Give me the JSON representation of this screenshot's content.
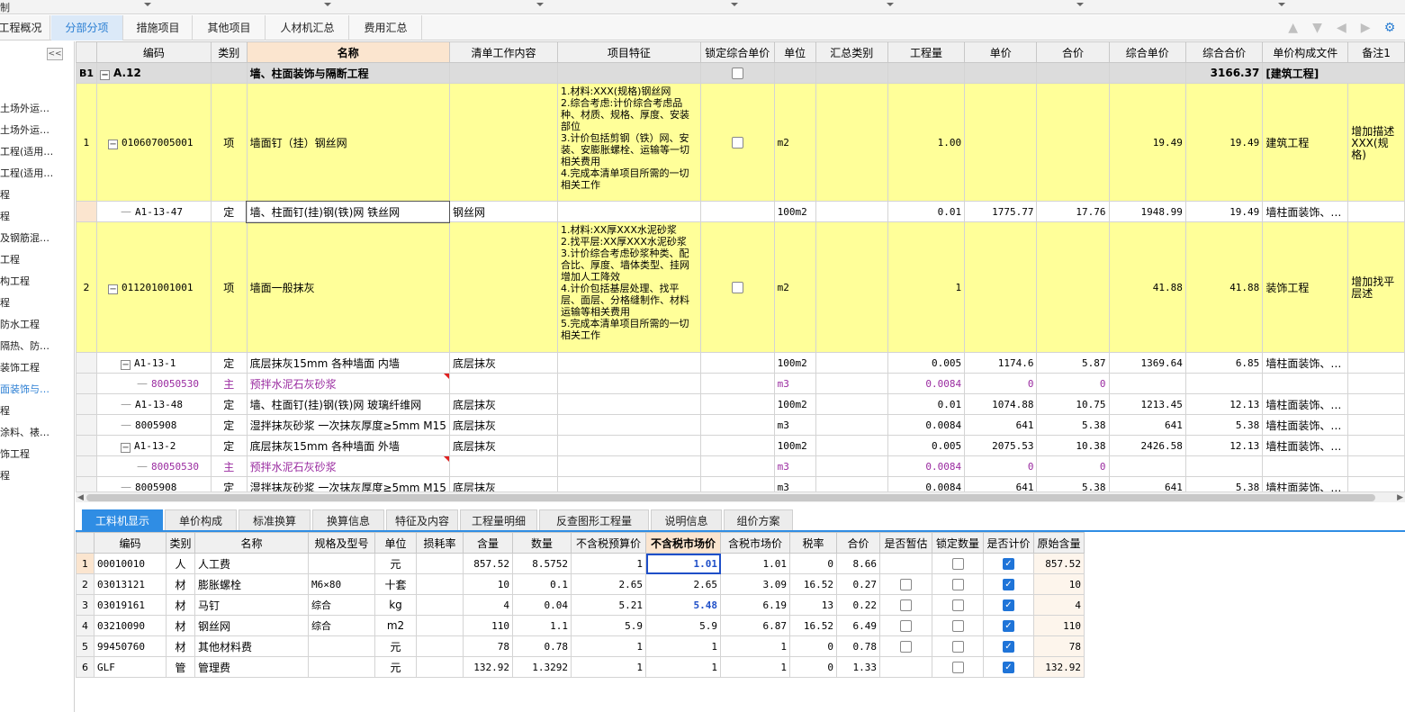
{
  "app": {
    "title_fragment": "制"
  },
  "tabs": [
    {
      "label": "工程概况",
      "active": false
    },
    {
      "label": "分部分项",
      "active": true
    },
    {
      "label": "措施项目",
      "active": false
    },
    {
      "label": "其他项目",
      "active": false
    },
    {
      "label": "人材机汇总",
      "active": false
    },
    {
      "label": "费用汇总",
      "active": false
    }
  ],
  "toolbar_icons": [
    "arrow-up-icon",
    "arrow-down-icon",
    "arrow-left-icon",
    "arrow-right-icon",
    "settings-icon"
  ],
  "leftnav": {
    "items": [
      {
        "label": "土场外运…",
        "active": false
      },
      {
        "label": "土场外运…",
        "active": false
      },
      {
        "label": "工程(适用…",
        "active": false
      },
      {
        "label": "工程(适用…",
        "active": false
      },
      {
        "label": "程",
        "active": false
      },
      {
        "label": "程",
        "active": false
      },
      {
        "label": "及钢筋混…",
        "active": false
      },
      {
        "label": "工程",
        "active": false
      },
      {
        "label": "构工程",
        "active": false
      },
      {
        "label": "程",
        "active": false
      },
      {
        "label": "防水工程",
        "active": false
      },
      {
        "label": "隔热、防…",
        "active": false
      },
      {
        "label": "装饰工程",
        "active": false
      },
      {
        "label": "面装饰与…",
        "active": true
      },
      {
        "label": "程",
        "active": false
      },
      {
        "label": "涂料、裱…",
        "active": false
      },
      {
        "label": "饰工程",
        "active": false
      },
      {
        "label": "程",
        "active": false
      }
    ]
  },
  "grid": {
    "headers": [
      "编码",
      "类别",
      "名称",
      "清单工作内容",
      "项目特征",
      "锁定综合单价",
      "单位",
      "汇总类别",
      "工程量",
      "单价",
      "合价",
      "综合单价",
      "综合合价",
      "单价构成文件",
      "备注1"
    ],
    "section": {
      "rn": "B1",
      "code": "A.12",
      "name": "墙、柱面装饰与隔断工程",
      "total": "3166.37",
      "file": "[建筑工程]"
    },
    "rows": [
      {
        "rn": "1",
        "code": "010607005001",
        "type": "项",
        "name": "墙面钉（挂）钢丝网",
        "content": "",
        "feature": "1.材料:XXX(规格)钢丝网\n2.综合考虑:计价综合考虑品种、材质、规格、厚度、安装部位\n3.计价包括剪钢（铁）网、安装、安膨胀螺栓、运输等一切相关费用\n4.完成本清单项目所需的一切相关工作",
        "unit": "m2",
        "summary": "",
        "qty": "1.00",
        "price": "",
        "total": "",
        "unit_comp": "19.49",
        "comp_total": "19.49",
        "file": "建筑工程",
        "note": "增加描述XXX(规格)"
      },
      {
        "rn": "",
        "code": "A1-13-47",
        "type": "定",
        "name": "墙、柱面钉(挂)钢(铁)网 铁丝网",
        "content": "钢丝网",
        "feature": "",
        "unit": "100m2",
        "summary": "",
        "qty": "0.01",
        "price": "1775.77",
        "total": "17.76",
        "unit_comp": "1948.99",
        "comp_total": "19.49",
        "file": "墙柱面装饰、…",
        "note": ""
      },
      {
        "rn": "2",
        "code": "011201001001",
        "type": "项",
        "name": "墙面一般抹灰",
        "content": "",
        "feature": "1.材料:XX厚XXX水泥砂浆\n2.找平层:XX厚XXX水泥砂浆\n3.计价综合考虑砂浆种类、配合比、厚度、墙体类型、挂网增加人工降效\n4.计价包括基层处理、找平层、面层、分格缝制作、材料运输等相关费用\n5.完成本清单项目所需的一切相关工作",
        "unit": "m2",
        "summary": "",
        "qty": "1",
        "price": "",
        "total": "",
        "unit_comp": "41.88",
        "comp_total": "41.88",
        "file": "装饰工程",
        "note": "增加找平层述"
      },
      {
        "rn": "",
        "code": "A1-13-1",
        "type": "定",
        "name": "底层抹灰15mm 各种墙面 内墙",
        "content": "底层抹灰",
        "feature": "",
        "unit": "100m2",
        "summary": "",
        "qty": "0.005",
        "price": "1174.6",
        "total": "5.87",
        "unit_comp": "1369.64",
        "comp_total": "6.85",
        "file": "墙柱面装饰、…",
        "note": ""
      },
      {
        "rn": "",
        "code": "80050530",
        "type": "主",
        "name": "预拌水泥石灰砂浆",
        "content": "",
        "feature": "",
        "unit": "m3",
        "summary": "",
        "qty": "0.0084",
        "price": "0",
        "total": "0",
        "unit_comp": "",
        "comp_total": "",
        "file": "",
        "note": ""
      },
      {
        "rn": "",
        "code": "A1-13-48",
        "type": "定",
        "name": "墙、柱面钉(挂)钢(铁)网 玻璃纤维网",
        "content": "底层抹灰",
        "feature": "",
        "unit": "100m2",
        "summary": "",
        "qty": "0.01",
        "price": "1074.88",
        "total": "10.75",
        "unit_comp": "1213.45",
        "comp_total": "12.13",
        "file": "墙柱面装饰、…",
        "note": ""
      },
      {
        "rn": "",
        "code": "8005908",
        "type": "定",
        "name": "湿拌抹灰砂浆 一次抹灰厚度≥5mm M15",
        "content": "底层抹灰",
        "feature": "",
        "unit": "m3",
        "summary": "",
        "qty": "0.0084",
        "price": "641",
        "total": "5.38",
        "unit_comp": "641",
        "comp_total": "5.38",
        "file": "墙柱面装饰、…",
        "note": ""
      },
      {
        "rn": "",
        "code": "A1-13-2",
        "type": "定",
        "name": "底层抹灰15mm 各种墙面 外墙",
        "content": "底层抹灰",
        "feature": "",
        "unit": "100m2",
        "summary": "",
        "qty": "0.005",
        "price": "2075.53",
        "total": "10.38",
        "unit_comp": "2426.58",
        "comp_total": "12.13",
        "file": "墙柱面装饰、…",
        "note": ""
      },
      {
        "rn": "",
        "code": "80050530",
        "type": "主",
        "name": "预拌水泥石灰砂浆",
        "content": "",
        "feature": "",
        "unit": "m3",
        "summary": "",
        "qty": "0.0084",
        "price": "0",
        "total": "0",
        "unit_comp": "",
        "comp_total": "",
        "file": "",
        "note": ""
      },
      {
        "rn": "",
        "code": "8005908",
        "type": "定",
        "name": "湿拌抹灰砂浆 一次抹灰厚度≥5mm M15",
        "content": "底层抹灰",
        "feature": "",
        "unit": "m3",
        "summary": "",
        "qty": "0.0084",
        "price": "641",
        "total": "5.38",
        "unit_comp": "641",
        "comp_total": "5.38",
        "file": "墙柱面装饰、…",
        "note": ""
      }
    ]
  },
  "bottom_tabs": [
    {
      "label": "工料机显示",
      "active": true
    },
    {
      "label": "单价构成",
      "active": false
    },
    {
      "label": "标准换算",
      "active": false
    },
    {
      "label": "换算信息",
      "active": false
    },
    {
      "label": "特征及内容",
      "active": false
    },
    {
      "label": "工程量明细",
      "active": false
    },
    {
      "label": "反查图形工程量",
      "active": false
    },
    {
      "label": "说明信息",
      "active": false
    },
    {
      "label": "组价方案",
      "active": false
    }
  ],
  "sub": {
    "headers": [
      "编码",
      "类别",
      "名称",
      "规格及型号",
      "单位",
      "损耗率",
      "含量",
      "数量",
      "不含税预算价",
      "不含税市场价",
      "含税市场价",
      "税率",
      "合价",
      "是否暂估",
      "锁定数量",
      "是否计价",
      "原始含量"
    ],
    "rows": [
      {
        "rn": "1",
        "code": "00010010",
        "type": "人",
        "name": "人工费",
        "spec": "",
        "unit": "元",
        "loss": "",
        "content": "857.52",
        "qty": "8.5752",
        "budget": "1",
        "market": "1.01",
        "tax_market": "1.01",
        "rate": "0",
        "total": "8.66",
        "est": "",
        "lock": false,
        "priced": true,
        "orig": "857.52"
      },
      {
        "rn": "2",
        "code": "03013121",
        "type": "材",
        "name": "膨胀螺栓",
        "spec": "M6×80",
        "unit": "十套",
        "loss": "",
        "content": "10",
        "qty": "0.1",
        "budget": "2.65",
        "market": "2.65",
        "tax_market": "3.09",
        "rate": "16.52",
        "total": "0.27",
        "est": false,
        "lock": false,
        "priced": true,
        "orig": "10"
      },
      {
        "rn": "3",
        "code": "03019161",
        "type": "材",
        "name": "马钉",
        "spec": "综合",
        "unit": "kg",
        "loss": "",
        "content": "4",
        "qty": "0.04",
        "budget": "5.21",
        "market": "5.48",
        "tax_market": "6.19",
        "rate": "13",
        "total": "0.22",
        "est": false,
        "lock": false,
        "priced": true,
        "orig": "4"
      },
      {
        "rn": "4",
        "code": "03210090",
        "type": "材",
        "name": "钢丝网",
        "spec": "综合",
        "unit": "m2",
        "loss": "",
        "content": "110",
        "qty": "1.1",
        "budget": "5.9",
        "market": "5.9",
        "tax_market": "6.87",
        "rate": "16.52",
        "total": "6.49",
        "est": false,
        "lock": false,
        "priced": true,
        "orig": "110"
      },
      {
        "rn": "5",
        "code": "99450760",
        "type": "材",
        "name": "其他材料费",
        "spec": "",
        "unit": "元",
        "loss": "",
        "content": "78",
        "qty": "0.78",
        "budget": "1",
        "market": "1",
        "tax_market": "1",
        "rate": "0",
        "total": "0.78",
        "est": false,
        "lock": false,
        "priced": true,
        "orig": "78"
      },
      {
        "rn": "6",
        "code": "GLF",
        "type": "管",
        "name": "管理费",
        "spec": "",
        "unit": "元",
        "loss": "",
        "content": "132.92",
        "qty": "1.3292",
        "budget": "1",
        "market": "1",
        "tax_market": "1",
        "rate": "0",
        "total": "1.33",
        "est": "",
        "lock": false,
        "priced": true,
        "orig": "132.92"
      }
    ]
  }
}
